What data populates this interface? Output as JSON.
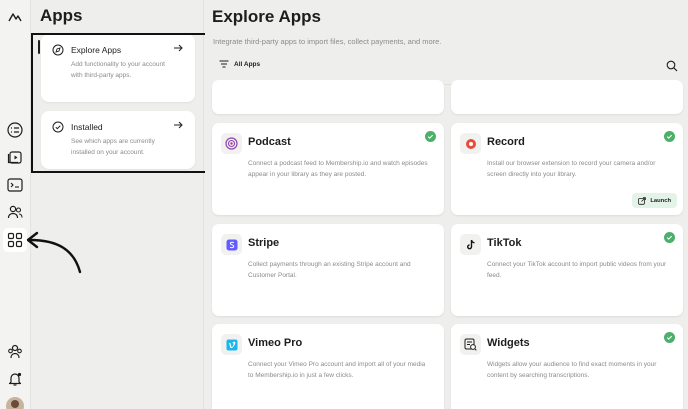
{
  "apps_panel": {
    "title": "Apps",
    "items": [
      {
        "title": "Explore Apps",
        "description": "Add functionality to your account with third-party apps."
      },
      {
        "title": "Installed",
        "description": "See which apps are currently installed on your account."
      }
    ]
  },
  "main": {
    "title": "Explore Apps",
    "subtitle": "Integrate third-party apps to import files, collect payments, and more.",
    "filter_label": "All Apps",
    "cards": [
      {
        "title": "Podcast",
        "description": "Connect a podcast feed to Membership.io and watch episodes appear in your library as they are posted.",
        "installed": true,
        "icon": "podcast-icon"
      },
      {
        "title": "Record",
        "description": "Install our browser extension to record your camera and/or screen directly into your library.",
        "installed": true,
        "icon": "record-icon",
        "action_label": "Launch"
      },
      {
        "title": "Stripe",
        "description": "Collect payments through an existing Stripe account and Customer Portal.",
        "installed": false,
        "icon": "stripe-icon"
      },
      {
        "title": "TikTok",
        "description": "Connect your TikTok account to import public videos from your feed.",
        "installed": true,
        "icon": "tiktok-icon"
      },
      {
        "title": "Vimeo Pro",
        "description": "Connect your Vimeo Pro account and import all of your media to Membership.io in just a few clicks.",
        "installed": false,
        "icon": "vimeo-icon"
      },
      {
        "title": "Widgets",
        "description": "Widgets allow your audience to find exact moments in your content by searching transcriptions.",
        "installed": true,
        "icon": "widgets-icon"
      }
    ]
  },
  "colors": {
    "accent_green": "#4caf6a",
    "podcast": "#8e44ad",
    "record": "#e74c3c",
    "stripe": "#635bff",
    "vimeo": "#1ab7ea"
  }
}
